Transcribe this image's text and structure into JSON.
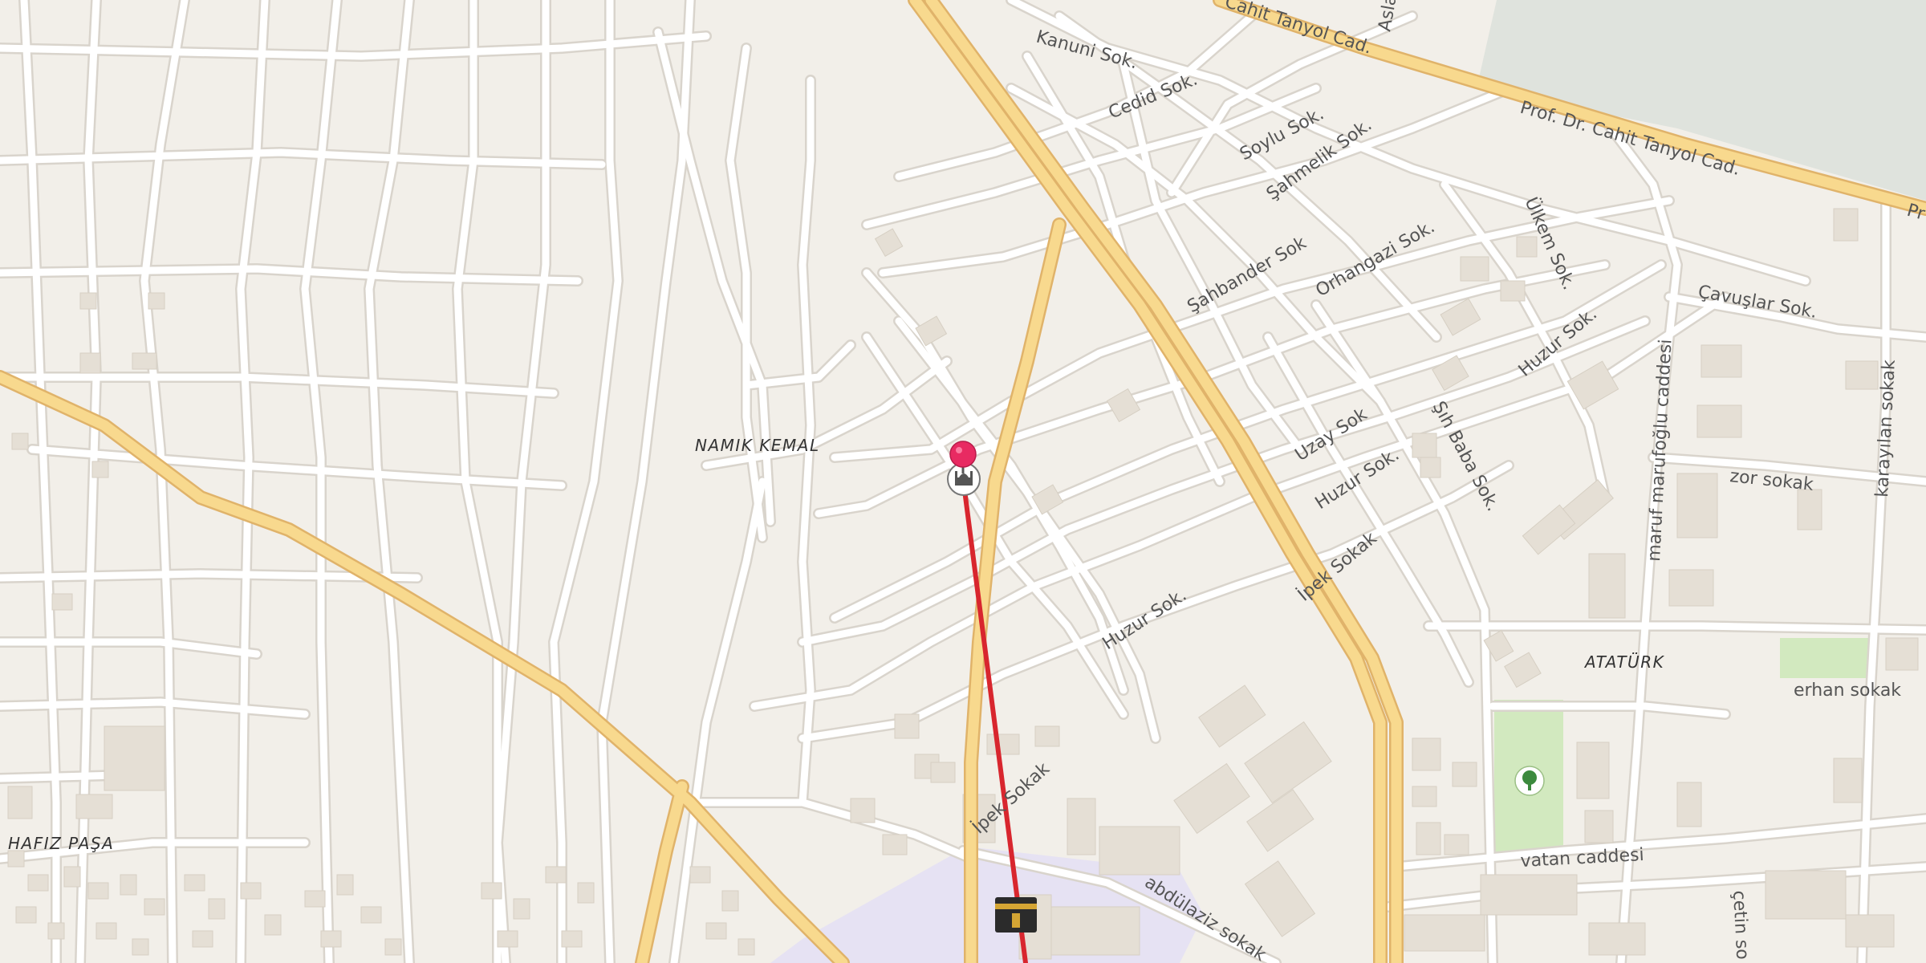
{
  "map": {
    "colors": {
      "land": "#f2efe9",
      "minor_road": "#ffffff",
      "minor_casing": "#d9d4cc",
      "major_road": "#f8d98e",
      "major_casing": "#e0b36a",
      "building": "#e5dfd5",
      "park": "#d2e9bf",
      "institution": "#e6e2f3",
      "water_area": "#dfe3dd",
      "route": "#d8262e",
      "pin": "#e82a62"
    },
    "districts": {
      "namik_kemal": "NAMIK KEMAL",
      "hafiz_pasa": "HAFIZ PAŞA",
      "ataturk": "ATATÜRK"
    },
    "streets": {
      "kanuni": "Kanuni Sok.",
      "cedid": "Cedid Sok.",
      "soylu": "Soylu Sok.",
      "sahmelik": "Şahmelik Sok.",
      "sahbander": "Şahbander Sok",
      "orhangazi": "Orhangazi Sok.",
      "ulkem": "Ülkem Sok.",
      "cavuslar": "Çavuşlar Sok.",
      "huzur_1": "Huzur Sok.",
      "huzur_2": "Huzur Sok.",
      "huzur_3": "Huzur Sok.",
      "uzay": "Uzay Sok",
      "sih_baba": "Şıh Baba Sok.",
      "ipek_sokak_1": "İpek Sokak",
      "ipek_sokak_2": "İpek Sokak",
      "zor_sokak": "zor sokak",
      "maruf": "maruf maruf​oğlu caddesi",
      "karayilan": "karayılan sokak",
      "erhan": "erhan sokak",
      "vatan": "vatan caddesi",
      "abdulaziz": "abdülaziz sokak",
      "cetin": "çetin so",
      "cahit_top": "Cahit Tanyol Cad.",
      "cahit_main": "Prof. Dr. Cahit Tanyol Cad.",
      "pr": "Pr",
      "asla": "Asla"
    },
    "icons": {
      "pin": "map-pin-icon",
      "mosque": "mosque-icon",
      "kaaba": "kaaba-icon",
      "park_tree": "tree-icon"
    }
  }
}
